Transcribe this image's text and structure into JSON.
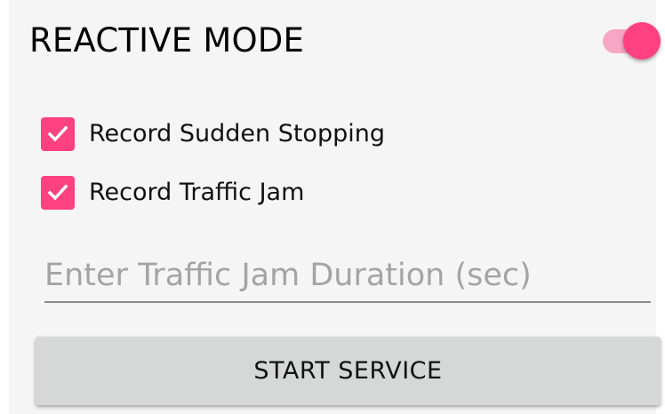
{
  "reactive_mode": {
    "title": "REACTIVE MODE",
    "toggle_on": true
  },
  "options": [
    {
      "label": "Record Sudden Stopping",
      "checked": true
    },
    {
      "label": "Record Traffic Jam",
      "checked": true
    }
  ],
  "duration_input": {
    "value": "",
    "placeholder": "Enter Traffic Jam Duration (sec)"
  },
  "start_button": {
    "label": "START SERVICE"
  },
  "colors": {
    "accent": "#ff4081",
    "switch_track": "#f7a6c3",
    "panel_background": "#f5f5f5",
    "button_background": "#d6d7d7",
    "placeholder_text": "#a4a4a4"
  },
  "icons": {
    "checkbox_mark": "checkmark-icon"
  }
}
